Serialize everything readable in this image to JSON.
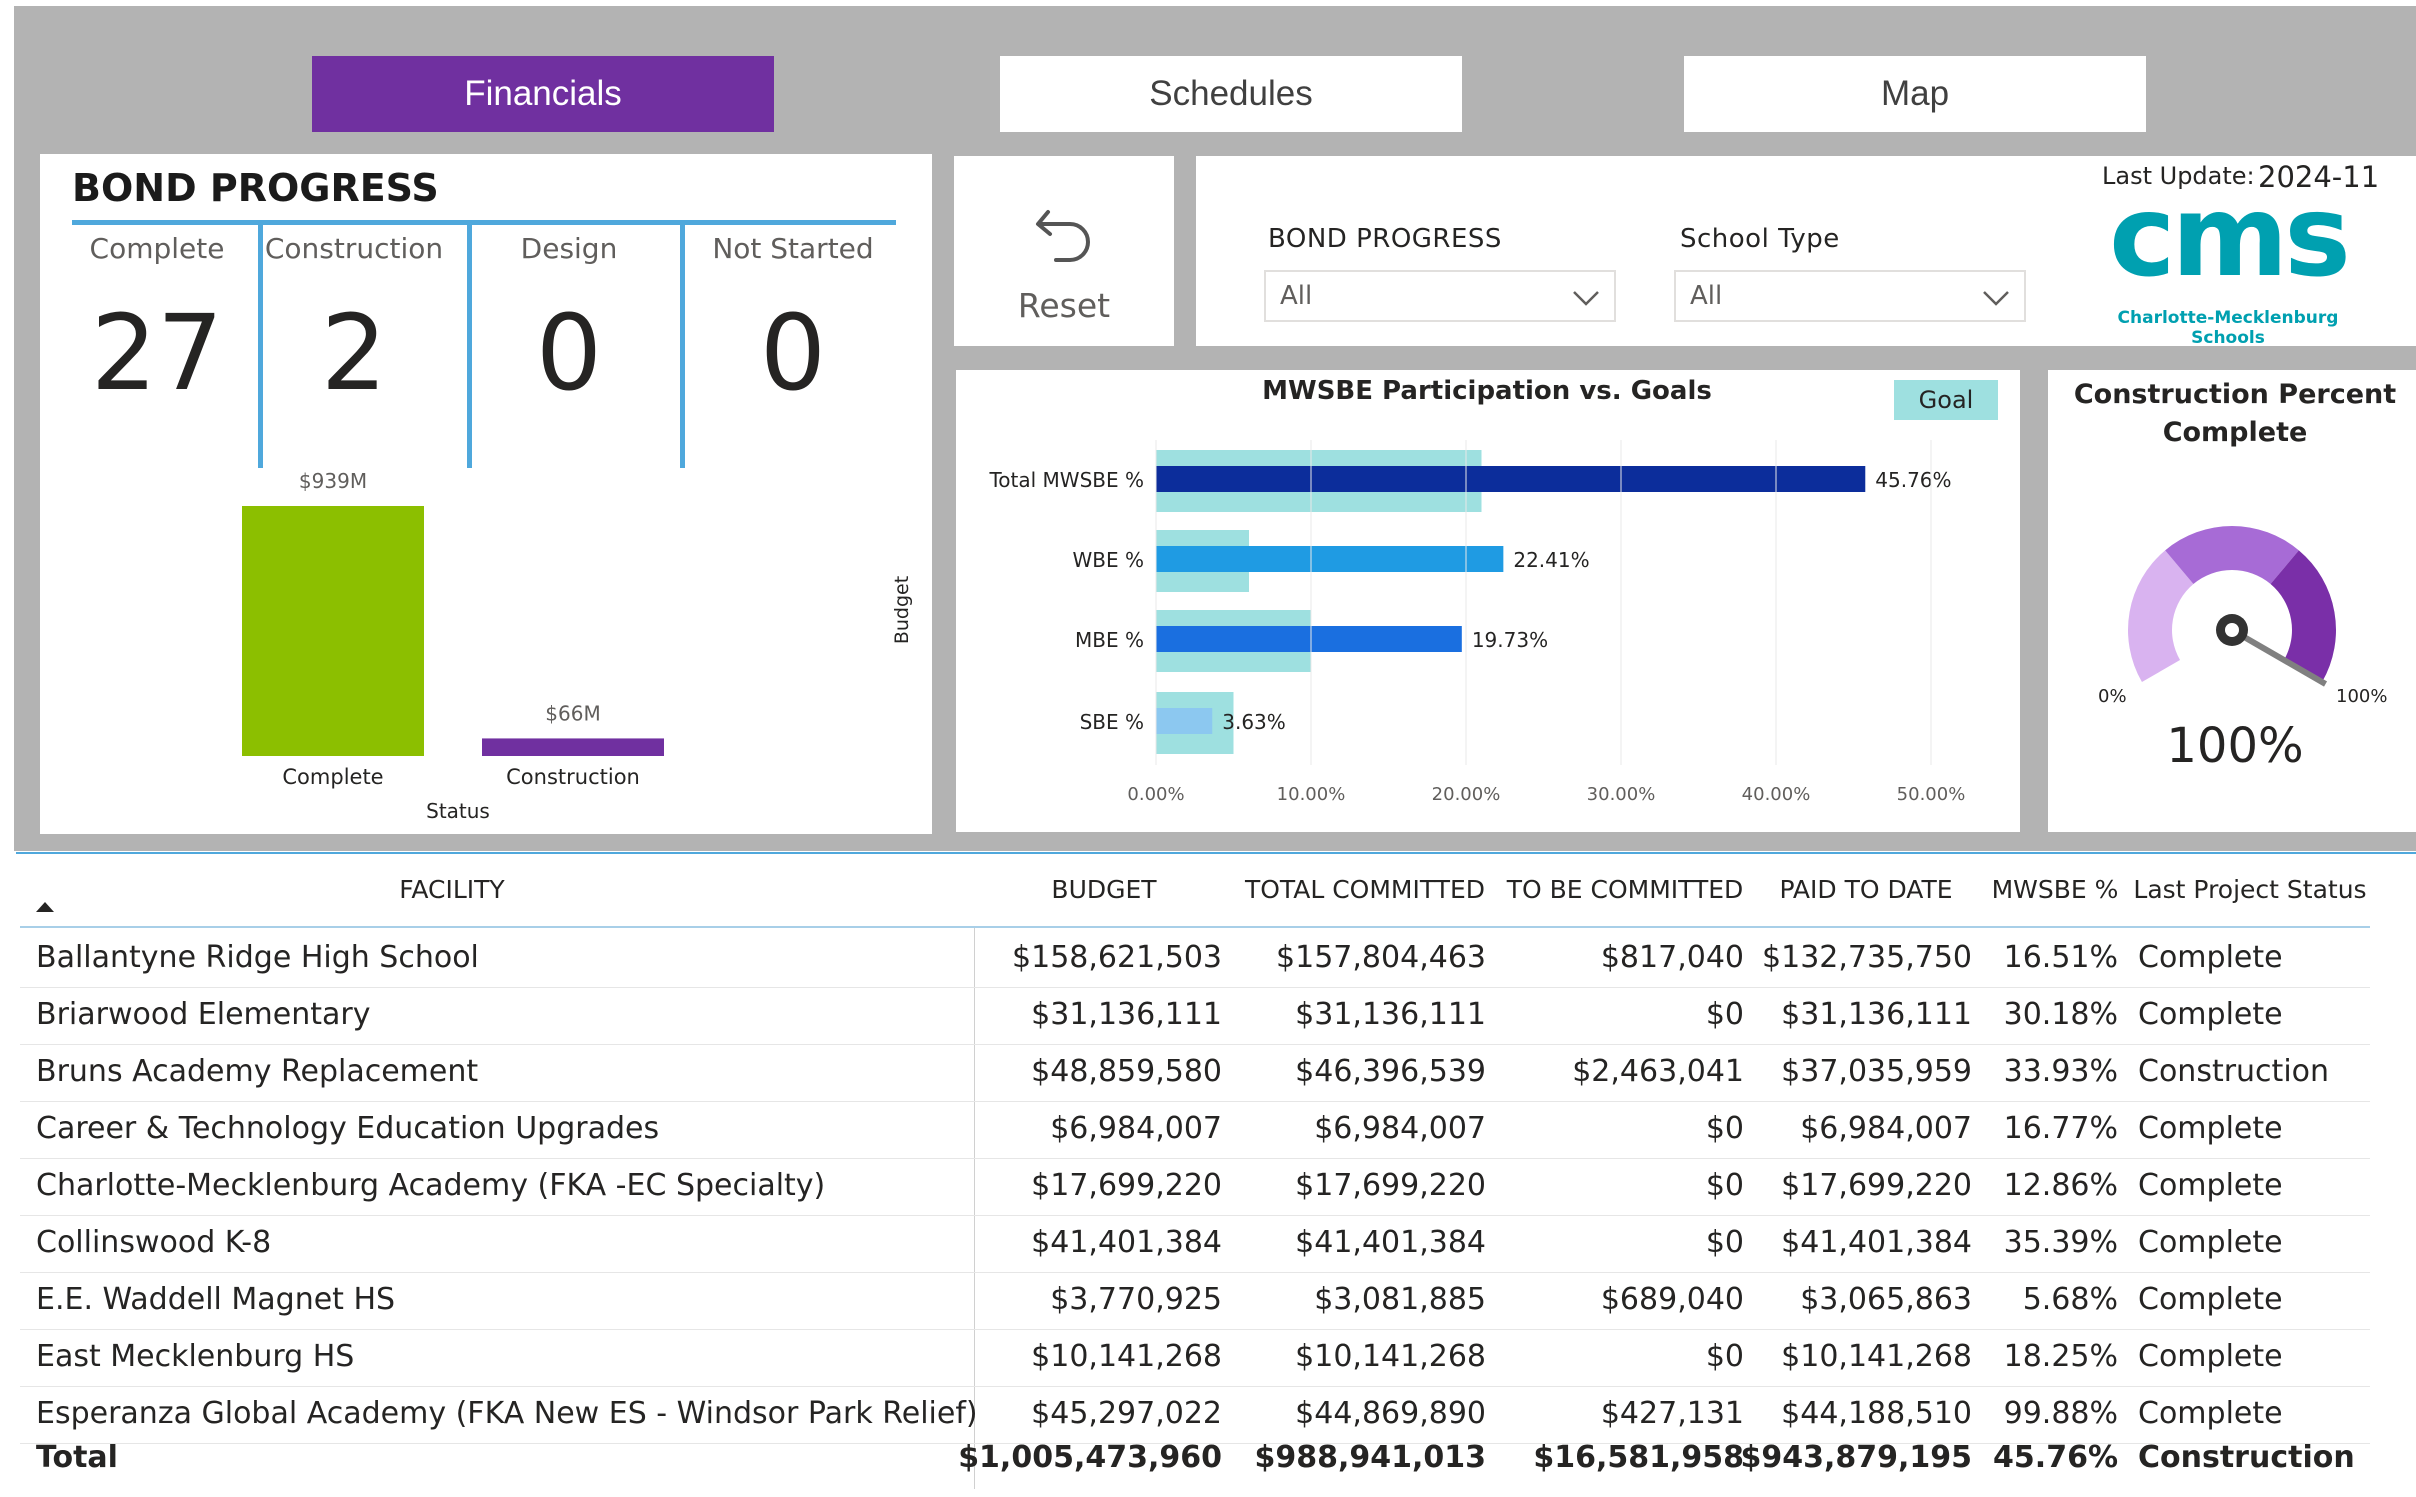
{
  "tabs": [
    {
      "label": "Financials",
      "active": true
    },
    {
      "label": "Schedules",
      "active": false
    },
    {
      "label": "Map",
      "active": false
    }
  ],
  "bond_progress": {
    "title": "BOND PROGRESS",
    "kpis": [
      {
        "label": "Complete",
        "value": "27"
      },
      {
        "label": "Construction",
        "value": "2"
      },
      {
        "label": "Design",
        "value": "0"
      },
      {
        "label": "Not Started",
        "value": "0"
      }
    ]
  },
  "budget_chart": {
    "ylabel": "Budget",
    "xlabel": "Status",
    "bars": [
      {
        "category": "Complete",
        "value": 939,
        "label": "$939M",
        "color": "#8cbf00"
      },
      {
        "category": "Construction",
        "value": 66,
        "label": "$66M",
        "color": "#7030a0"
      }
    ]
  },
  "reset": {
    "label": "Reset"
  },
  "filters": {
    "bond_progress": {
      "label": "BOND PROGRESS",
      "value": "All"
    },
    "school_type": {
      "label": "School Type",
      "value": "All"
    }
  },
  "last_update": {
    "label": "Last Update:",
    "value": "2024-11"
  },
  "logo": {
    "text": "cms",
    "subtitle": "Charlotte-Mecklenburg Schools",
    "color": "#00a0b0"
  },
  "chart_data": [
    {
      "type": "bar",
      "title": "MWSBE Participation vs. Goals",
      "legend": "Goal",
      "categories": [
        "Total MWSBE %",
        "WBE %",
        "MBE %",
        "SBE %"
      ],
      "series": [
        {
          "name": "Goal",
          "values": [
            21.0,
            6.0,
            10.0,
            5.0
          ],
          "color": "#9ee0e0"
        }
      ],
      "values": [
        45.76,
        22.41,
        19.73,
        3.63
      ],
      "value_labels": [
        "45.76%",
        "22.41%",
        "19.73%",
        "3.63%"
      ],
      "bar_colors": [
        "#0c2d9b",
        "#1f9be3",
        "#1a6fe0",
        "#8cc8f0"
      ],
      "x_ticks": [
        "0.00%",
        "10.00%",
        "20.00%",
        "30.00%",
        "40.00%",
        "50.00%"
      ],
      "xlim": [
        0,
        50
      ]
    },
    {
      "type": "bar",
      "ylabel": "Budget",
      "xlabel": "Status",
      "categories": [
        "Complete",
        "Construction"
      ],
      "values": [
        939,
        66
      ],
      "value_labels": [
        "$939M",
        "$66M"
      ]
    }
  ],
  "gauge": {
    "title": "Construction Percent Complete",
    "value": 100,
    "value_label": "100%",
    "min_label": "0%",
    "max_label": "100%"
  },
  "table": {
    "columns": [
      "FACILITY",
      "BUDGET",
      "TOTAL COMMITTED",
      "TO BE COMMITTED",
      "PAID TO DATE",
      "MWSBE %",
      "Last Project Status"
    ],
    "rows": [
      [
        "Ballantyne Ridge High School",
        "$158,621,503",
        "$157,804,463",
        "$817,040",
        "$132,735,750",
        "16.51%",
        "Complete"
      ],
      [
        "Briarwood Elementary",
        "$31,136,111",
        "$31,136,111",
        "$0",
        "$31,136,111",
        "30.18%",
        "Complete"
      ],
      [
        "Bruns Academy Replacement",
        "$48,859,580",
        "$46,396,539",
        "$2,463,041",
        "$37,035,959",
        "33.93%",
        "Construction"
      ],
      [
        "Career & Technology Education Upgrades",
        "$6,984,007",
        "$6,984,007",
        "$0",
        "$6,984,007",
        "16.77%",
        "Complete"
      ],
      [
        "Charlotte-Mecklenburg Academy (FKA -EC Specialty)",
        "$17,699,220",
        "$17,699,220",
        "$0",
        "$17,699,220",
        "12.86%",
        "Complete"
      ],
      [
        "Collinswood K-8",
        "$41,401,384",
        "$41,401,384",
        "$0",
        "$41,401,384",
        "35.39%",
        "Complete"
      ],
      [
        "E.E. Waddell Magnet HS",
        "$3,770,925",
        "$3,081,885",
        "$689,040",
        "$3,065,863",
        "5.68%",
        "Complete"
      ],
      [
        "East Mecklenburg HS",
        "$10,141,268",
        "$10,141,268",
        "$0",
        "$10,141,268",
        "18.25%",
        "Complete"
      ],
      [
        "Esperanza Global Academy (FKA New ES - Windsor Park Relief)",
        "$45,297,022",
        "$44,869,890",
        "$427,131",
        "$44,188,510",
        "99.88%",
        "Complete"
      ]
    ],
    "total": [
      "Total",
      "$1,005,473,960",
      "$988,941,013",
      "$16,581,958",
      "$943,879,195",
      "45.76%",
      "Construction"
    ]
  }
}
